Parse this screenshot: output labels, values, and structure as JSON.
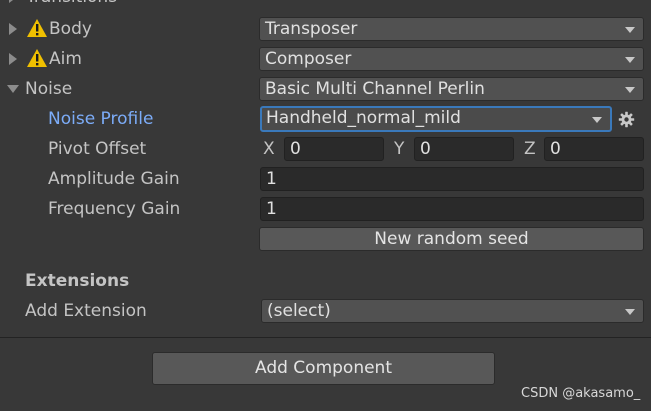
{
  "transitions_label": "Transitions",
  "rows": {
    "body": {
      "label": "Body",
      "value": "Transposer"
    },
    "aim": {
      "label": "Aim",
      "value": "Composer"
    },
    "noise": {
      "label": "Noise",
      "value": "Basic Multi Channel Perlin"
    }
  },
  "noise_settings": {
    "profile": {
      "label": "Noise Profile",
      "value": "Handheld_normal_mild"
    },
    "pivot_offset": {
      "label": "Pivot Offset",
      "x_label": "X",
      "x": "0",
      "y_label": "Y",
      "y": "0",
      "z_label": "Z",
      "z": "0"
    },
    "amplitude_gain": {
      "label": "Amplitude Gain",
      "value": "1"
    },
    "frequency_gain": {
      "label": "Frequency Gain",
      "value": "1"
    },
    "random_seed_button": "New random seed"
  },
  "extensions": {
    "heading": "Extensions",
    "add_label": "Add Extension",
    "add_value": "(select)"
  },
  "add_component_button": "Add Component",
  "watermark": "CSDN @akasamo_",
  "colors": {
    "panel_bg": "#383838",
    "accent_label": "#7cacf8",
    "focus_border": "#3a79bb",
    "warning_yellow": "#f0c000"
  },
  "icons": [
    "foldout-arrow-right-icon",
    "foldout-arrow-down-icon",
    "warning-icon",
    "dropdown-caret-icon",
    "gear-icon"
  ]
}
